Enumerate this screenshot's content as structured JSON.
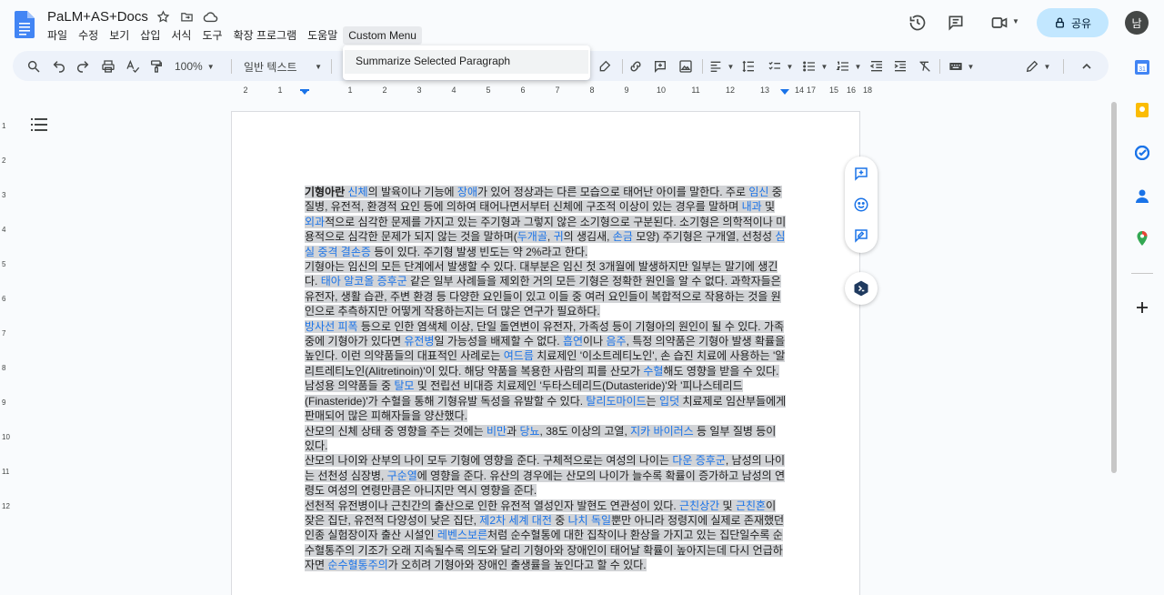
{
  "doc": {
    "title": "PaLM+AS+Docs"
  },
  "menubar": [
    "파일",
    "수정",
    "보기",
    "삽입",
    "서식",
    "도구",
    "확장 프로그램",
    "도움말",
    "Custom Menu"
  ],
  "share": {
    "label": "공유"
  },
  "avatar": {
    "initial": "남"
  },
  "toolbar": {
    "zoom": "100%",
    "style": "일반 텍스트"
  },
  "dropdown": {
    "items": [
      "Summarize Selected Paragraph"
    ]
  },
  "ruler": {
    "labels": [
      "2",
      "1",
      "1",
      "2",
      "3",
      "4",
      "5",
      "6",
      "7",
      "8",
      "9",
      "10",
      "11",
      "12",
      "13",
      "14",
      "15",
      "16",
      "17",
      "18"
    ]
  },
  "vruler": {
    "labels": [
      "1",
      "2",
      "3",
      "4",
      "5",
      "6",
      "7",
      "8",
      "9",
      "10",
      "11",
      "12"
    ]
  },
  "content": {
    "p1": [
      {
        "t": "기형아란 ",
        "b": true
      },
      {
        "t": "신체",
        "l": true
      },
      {
        "t": "의 발육이나 기능에 "
      },
      {
        "t": "장애",
        "l": true
      },
      {
        "t": "가 있어 정상과는 다른 모습으로 태어난 아이를 말한다. 주로 "
      },
      {
        "t": "임신",
        "l": true
      },
      {
        "t": " 중 질병, 유전적, 환경적 요인 등에 의하여 태어나면서부터 신체에 구조적 이상이 있는 경우를 말하며 "
      },
      {
        "t": "내과",
        "l": true
      },
      {
        "t": " 및 "
      },
      {
        "t": "외과",
        "l": true
      },
      {
        "t": "적으로 심각한 문제를 가지고 있는 주기형과 그렇지 않은 소기형으로 구분된다. 소기형은 의학적이나 미용적으로 심각한 문제가 되지 않는 것을 말하며("
      },
      {
        "t": "두개골",
        "l": true
      },
      {
        "t": ", "
      },
      {
        "t": "귀",
        "l": true
      },
      {
        "t": "의 생김새, "
      },
      {
        "t": "손금",
        "l": true
      },
      {
        "t": " 모양) 주기형은 구개열, 선청성 "
      },
      {
        "t": "심실 중격 결손증",
        "l": true
      },
      {
        "t": " 등이 있다. 주기형 발생 빈도는 약 2%라고 한다."
      }
    ],
    "p2": [
      {
        "t": "기형아는 임신의 모든 단계에서 발생할 수 있다. 대부분은 임신 첫 3개월에 발생하지만 일부는 말기에 생긴다. "
      },
      {
        "t": "태아 알코올 증후군",
        "l": true
      },
      {
        "t": " 같은 일부 사례들을 제외한 거의 모든 기형은 정확한 원인을 알 수 없다. 과학자들은 유전자, 생활 습관, 주변 환경 등 다양한 요인들이 있고 이들 중 여러 요인들이 복합적으로 작용하는 것을 원인으로 추측하지만 어떻게 작용하는지는 더 많은 연구가 필요하다."
      }
    ],
    "p3": [
      {
        "t": "방사선 피폭",
        "l": true
      },
      {
        "t": " 등으로 인한 염색체 이상, 단일 돌연변이 유전자, 가족성 등이 기형아의 원인이 될 수 있다. 가족중에 기형아가 있다면 "
      },
      {
        "t": "유전병",
        "l": true
      },
      {
        "t": "일 가능성을 배제할 수 없다. "
      },
      {
        "t": "흡연",
        "l": true
      },
      {
        "t": "이나 "
      },
      {
        "t": "음주",
        "l": true
      },
      {
        "t": ", 특정 의약품은 기형아 발생 확률을 높인다. 이런 의약품들의 대표적인 사례로는 "
      },
      {
        "t": "여드름",
        "l": true
      },
      {
        "t": " 치료제인 '이소트레티노인', 손 습진 치료에 사용하는 '알리트레티노인(Alitretinoin)'이 있다. 해당 약품을 복용한 사람의 피를 산모가 "
      },
      {
        "t": "수혈",
        "l": true
      },
      {
        "t": "해도 영향을 받을 수 있다. 남성용 의약품들 중 "
      },
      {
        "t": "탈모",
        "l": true
      },
      {
        "t": " 및 전립선 비대증 치료제인 '두타스테리드(Dutasteride)'와 '피나스테리드(Finasteride)'가 수혈을 통해 기형유발 독성을 유발할 수 있다. "
      },
      {
        "t": "탈리도마이드",
        "l": true
      },
      {
        "t": "는 "
      },
      {
        "t": "입덧",
        "l": true
      },
      {
        "t": " 치료제로 임산부들에게 판매되어 많은 피해자들을 양산했다."
      }
    ],
    "p4": [
      {
        "t": "산모의 신체 상태 중 영향을 주는 것에는 "
      },
      {
        "t": "비만",
        "l": true
      },
      {
        "t": "과 "
      },
      {
        "t": "당뇨",
        "l": true
      },
      {
        "t": ", 38도 이상의 고열, "
      },
      {
        "t": "지카 바이러스",
        "l": true
      },
      {
        "t": " 등 일부 질병 등이 있다."
      }
    ],
    "p5": [
      {
        "t": "산모의 나이와 산부의 나이 모두 기형에 영향을 준다. 구체적으로는 여성의 나이는 "
      },
      {
        "t": "다운 증후군",
        "l": true
      },
      {
        "t": ", 남성의 나이는 선천성 심장병, "
      },
      {
        "t": "구순열",
        "l": true
      },
      {
        "t": "에 영향을 준다. 유산의 경우에는 산모의 나이가 늘수록 확률이 증가하고 남성의 연령도 여성의 연령만큼은 아니지만 역시 영향을 준다."
      }
    ],
    "p6": [
      {
        "t": "선천적 유전병이나 근친간의 출산으로 인한 유전적 열성인자 발현도 연관성이 있다. "
      },
      {
        "t": "근친상간",
        "l": true
      },
      {
        "t": " 및 "
      },
      {
        "t": "근친혼",
        "l": true
      },
      {
        "t": "이 잦은 집단, 유전적 다양성이 낮은 집단, "
      },
      {
        "t": "제2차 세계 대전",
        "l": true
      },
      {
        "t": " 중 "
      },
      {
        "t": "나치 독일",
        "l": true
      },
      {
        "t": "뿐만 아니라 정령지에 실제로 존재했던 인종 실험장이자 출산 시설인 "
      },
      {
        "t": "레벤스보른",
        "l": true
      },
      {
        "t": "처럼 순수혈통에 대한 집착이나 환상을 가지고 있는 집단일수록 순수혈통주의 기조가 오래 지속될수록 의도와 달리 기형아와 장애인이 태어날 확률이 높아지는데 다시 언급하자면 "
      },
      {
        "t": "순수혈통주의",
        "l": true
      },
      {
        "t": "가 오히려 기형아와 장애인 출생률을 높인다고 할 수 있다."
      }
    ]
  },
  "colors": {
    "accent": "#1a73e8",
    "share_bg": "#c2e7ff",
    "toolbar_bg": "#edf2fa",
    "selection": "#d2d4d7"
  }
}
